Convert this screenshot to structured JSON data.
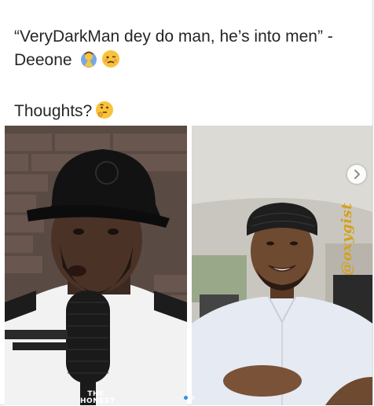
{
  "post": {
    "caption": "“VeryDarkMan dey do man, he’s into men” - Deeone",
    "caption_emojis": [
      "praying-person-emoji",
      "woozy-face-emoji"
    ],
    "thoughts": "Thoughts?",
    "thoughts_emoji": "thinking-face-emoji"
  },
  "media": {
    "watermark": "@oxygist",
    "podcast_logo_top": "THE",
    "podcast_logo_bottom": "HONEST",
    "next_icon": "chevron-right-icon",
    "pager": {
      "count": 2,
      "active_index": 0
    }
  },
  "colors": {
    "text": "#262626",
    "watermark": "#d4a11a",
    "active_dot": "#2f8ff0"
  }
}
